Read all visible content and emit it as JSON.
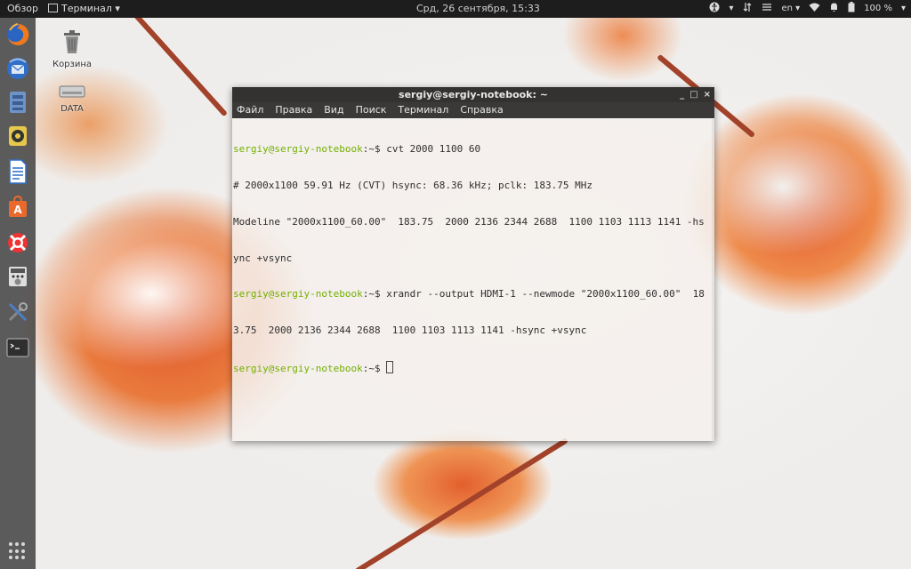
{
  "top_panel": {
    "activities": "Обзор",
    "app_menu": "Терминал",
    "clock": "Срд, 26 сентября, 15:33",
    "keyboard_layout": "en",
    "battery": "100 %"
  },
  "desktop": {
    "icons": [
      {
        "label": "Корзина"
      },
      {
        "label": "DATA"
      }
    ]
  },
  "terminal": {
    "title": "sergiy@sergiy-notebook: ~",
    "menu": [
      "Файл",
      "Правка",
      "Вид",
      "Поиск",
      "Терминал",
      "Справка"
    ],
    "lines": [
      {
        "prompt": "sergiy@sergiy-notebook",
        "rest": ":~$ cvt 2000 1100 60"
      },
      {
        "prompt": "",
        "rest": "# 2000x1100 59.91 Hz (CVT) hsync: 68.36 kHz; pclk: 183.75 MHz"
      },
      {
        "prompt": "",
        "rest": "Modeline \"2000x1100_60.00\"  183.75  2000 2136 2344 2688  1100 1103 1113 1141 -hs"
      },
      {
        "prompt": "",
        "rest": "ync +vsync"
      },
      {
        "prompt": "sergiy@sergiy-notebook",
        "rest": ":~$ xrandr --output HDMI-1 --newmode \"2000x1100_60.00\"  18"
      },
      {
        "prompt": "",
        "rest": "3.75  2000 2136 2344 2688  1100 1103 1113 1141 -hsync +vsync"
      },
      {
        "prompt": "sergiy@sergiy-notebook",
        "rest": ":~$ "
      }
    ]
  },
  "colors": {
    "prompt": "#72b000",
    "panel": "#1d1d1d",
    "dock": "#3c3a3a"
  },
  "dock_icons": [
    "firefox-icon",
    "thunderbird-icon",
    "files-icon",
    "rhythmbox-icon",
    "writer-icon",
    "software-center-icon",
    "help-icon",
    "calculator-icon",
    "settings-tools-icon",
    "terminal-icon"
  ]
}
